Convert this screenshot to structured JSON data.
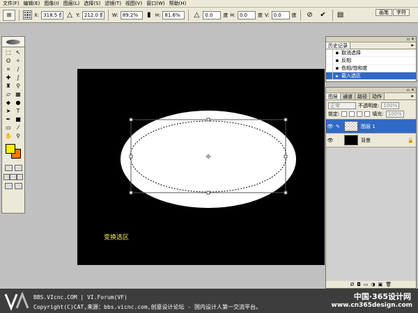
{
  "menu": [
    "文件(F)",
    "编辑(E)",
    "图像(I)",
    "图层(L)",
    "选择(S)",
    "滤镜(T)",
    "视图(V)",
    "窗口(W)",
    "帮助(H)"
  ],
  "options": {
    "x_label": "X:",
    "x_value": "318.5 像",
    "y_label": "Y:",
    "y_value": "212.0 像",
    "w_label": "W:",
    "w_value": "89.2%",
    "h_label": "H:",
    "h_value": "81.6%",
    "angle_value": "0.0",
    "angle_unit": "度",
    "hskew_label": "H:",
    "hskew_value": "0.0",
    "hskew_unit": "度",
    "vskew_label": "V:",
    "vskew_value": "0.0",
    "vskew_unit": "度",
    "cancel_icon": "⊘",
    "commit_icon": "✔",
    "tab_brushes": "画笔",
    "tab_character": "字符"
  },
  "canvas": {
    "caption": "变换选区"
  },
  "history": {
    "tab": "历史记录",
    "items": [
      "取消选择",
      "反相",
      "色相/饱和度",
      "载入选区"
    ]
  },
  "layers": {
    "tabs": [
      "图层",
      "通道",
      "路径",
      "动作"
    ],
    "blend_mode": "正常",
    "opacity_label": "不透明度:",
    "opacity_value": "100%",
    "lock_label": "锁定:",
    "fill_label": "填充:",
    "fill_value": "100%",
    "items": [
      {
        "name": "图层 1"
      },
      {
        "name": "背景"
      }
    ]
  },
  "footer": {
    "line1": "BBS.VIcnc.COM | VI.Forum(VF)",
    "line2": "Copyright(C)CAT,来源：bbs.vicnc.com,创意设计论坛 - 国内设计人第一交流平台。",
    "brand_cn": "中国·365设计网",
    "brand_url": "www.cn365design.com"
  }
}
